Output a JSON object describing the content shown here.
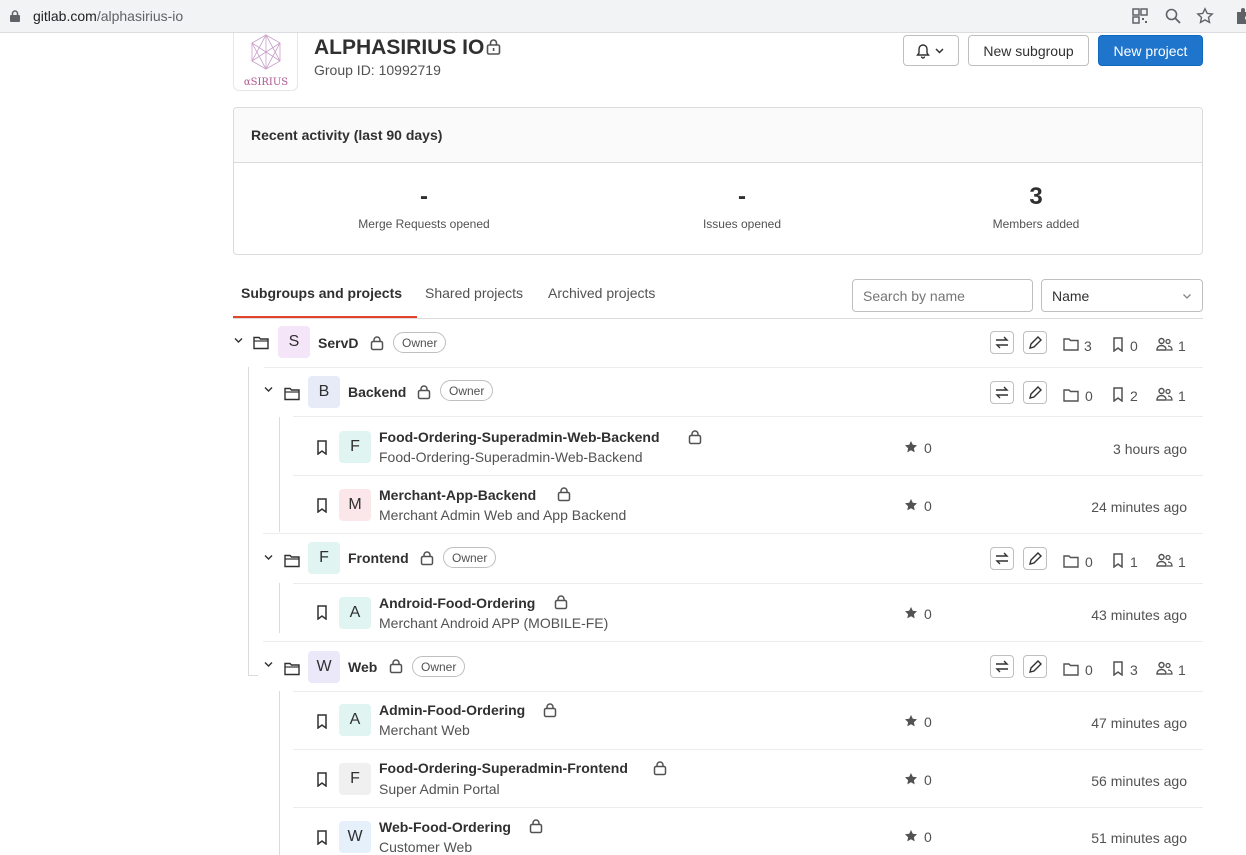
{
  "browser": {
    "url_host": "gitlab.com",
    "url_path": "/alphasirius-io"
  },
  "group": {
    "logo_text": "αSIRIUS",
    "name": "ALPHASIRIUS IO",
    "id_text": "Group ID: 10992719",
    "new_subgroup": "New subgroup",
    "new_project": "New project"
  },
  "activity": {
    "title": "Recent activity (last 90 days)",
    "stats": [
      {
        "value": "-",
        "label": "Merge Requests opened"
      },
      {
        "value": "-",
        "label": "Issues opened"
      },
      {
        "value": "3",
        "label": "Members added"
      }
    ]
  },
  "tabs": [
    "Subgroups and projects",
    "Shared projects",
    "Archived projects"
  ],
  "search": {
    "placeholder": "Search by name"
  },
  "sort": {
    "selected": "Name"
  },
  "role": "Owner",
  "tree": {
    "servd": {
      "letter": "S",
      "name": "ServD",
      "subgroups": "3",
      "projects": "0",
      "members": "1",
      "color": "#f4e6f8"
    },
    "backend": {
      "letter": "B",
      "name": "Backend",
      "subgroups": "0",
      "projects": "2",
      "members": "1",
      "color": "#e7ebf8"
    },
    "frontend": {
      "letter": "F",
      "name": "Frontend",
      "subgroups": "0",
      "projects": "1",
      "members": "1",
      "color": "#e0f4f1"
    },
    "web": {
      "letter": "W",
      "name": "Web",
      "subgroups": "0",
      "projects": "3",
      "members": "1",
      "color": "#ebe9f9"
    },
    "projects": [
      {
        "letter": "F",
        "name": "Food-Ordering-Superadmin-Web-Backend",
        "desc": "Food-Ordering-Superadmin-Web-Backend",
        "stars": "0",
        "time": "3 hours ago",
        "color": "#e0f4f1"
      },
      {
        "letter": "M",
        "name": "Merchant-App-Backend",
        "desc": "Merchant Admin Web and App Backend",
        "stars": "0",
        "time": "24 minutes ago",
        "color": "#fbe7ea"
      },
      {
        "letter": "A",
        "name": "Android-Food-Ordering",
        "desc": "Merchant Android APP (MOBILE-FE)",
        "stars": "0",
        "time": "43 minutes ago",
        "color": "#e0f4f1"
      },
      {
        "letter": "A",
        "name": "Admin-Food-Ordering",
        "desc": "Merchant Web",
        "stars": "0",
        "time": "47 minutes ago",
        "color": "#e0f4f1"
      },
      {
        "letter": "F",
        "name": "Food-Ordering-Superadmin-Frontend",
        "desc": "Super Admin Portal",
        "stars": "0",
        "time": "56 minutes ago",
        "color": "#f0f0f0"
      },
      {
        "letter": "W",
        "name": "Web-Food-Ordering",
        "desc": "Customer Web",
        "stars": "0",
        "time": "51 minutes ago",
        "color": "#e6f0fb"
      }
    ]
  }
}
